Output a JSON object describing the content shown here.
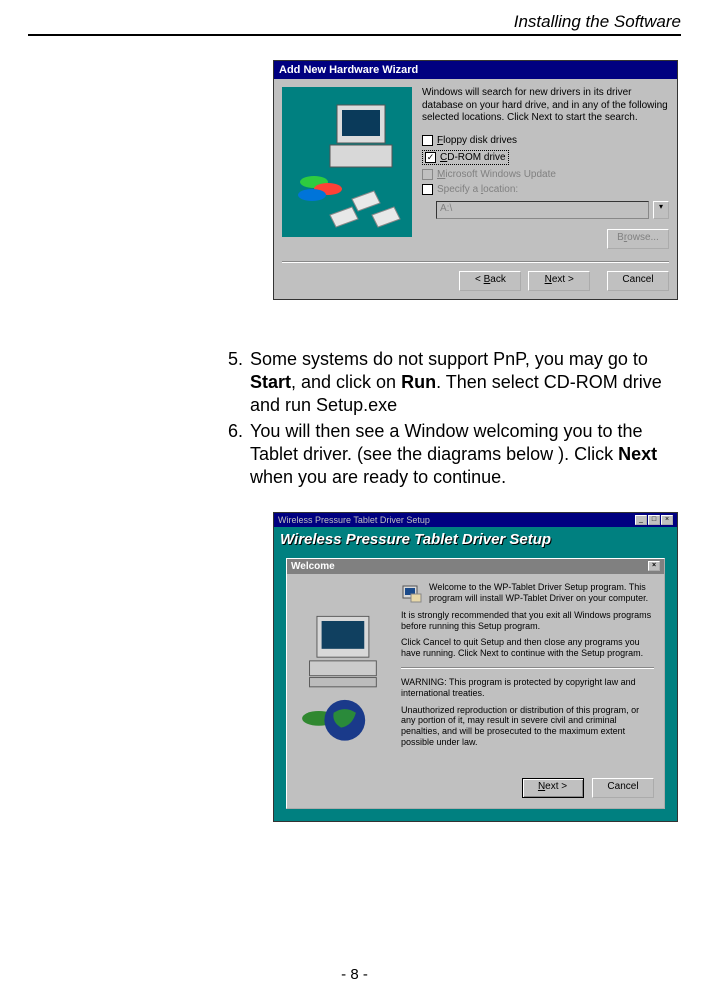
{
  "header": {
    "title": "Installing the Software"
  },
  "wizard": {
    "title": "Add New Hardware Wizard",
    "intro": "Windows will search for new drivers in its driver database on your hard drive, and in any of the following selected locations. Click Next to start the search.",
    "floppy_label": "Floppy disk drives",
    "cdrom_label": "CD-ROM drive",
    "winupdate_label": "Microsoft Windows Update",
    "specify_label": "Specify a location:",
    "location_value": "A:\\",
    "browse_label": "Browse...",
    "back_label": "< Back",
    "next_label": "Next >",
    "cancel_label": "Cancel"
  },
  "instructions": {
    "item5_num": "5.",
    "item5_p1": "Some systems do not support PnP, you may go to ",
    "item5_b1": "Start",
    "item5_p2": ", and click on ",
    "item5_b2": "Run",
    "item5_p3": ". Then select CD-ROM drive and run Setup.exe",
    "item6_num": "6.",
    "item6_p1": "You will then see a Window welcoming you to the Tablet driver. (see the diagrams below ).  Click ",
    "item6_b1": "Next",
    "item6_p2": " when you are ready to continue."
  },
  "welcome": {
    "outer_title": "Wireless Pressure Tablet  Driver Setup",
    "banner": "Wireless Pressure Tablet  Driver Setup",
    "dialog_title": "Welcome",
    "p1": "Welcome to the WP-Tablet Driver Setup program.  This program will install WP-Tablet Driver on your computer.",
    "p2": "It is strongly recommended that you exit all Windows programs before running this Setup program.",
    "p3": "Click Cancel to quit Setup and then close any programs you have running.  Click Next to continue with the Setup program.",
    "p4": "WARNING: This program is protected by copyright law and international treaties.",
    "p5": "Unauthorized reproduction or distribution of this program, or any portion of it, may result in severe civil and criminal penalties, and will be prosecuted to the maximum extent possible under law.",
    "next_label": "Next >",
    "cancel_label": "Cancel"
  },
  "footer": {
    "page": "- 8 -"
  }
}
